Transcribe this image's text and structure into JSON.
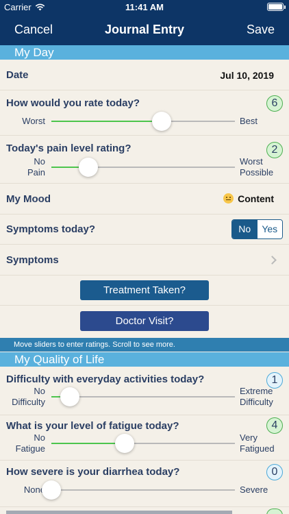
{
  "status_bar": {
    "carrier": "Carrier",
    "time": "11:41 AM"
  },
  "nav": {
    "cancel": "Cancel",
    "title": "Journal Entry",
    "save": "Save"
  },
  "sections": {
    "my_day": "My Day",
    "quality_of_life": "My Quality of Life"
  },
  "date": {
    "label": "Date",
    "value": "Jul 10, 2019"
  },
  "rate_today": {
    "label": "How would you rate today?",
    "value": "6",
    "min_label": "Worst",
    "max_label": "Best",
    "fraction": 0.6
  },
  "pain": {
    "label": "Today's pain level rating?",
    "value": "2",
    "min_label_1": "No",
    "min_label_2": "Pain",
    "max_label_1": "Worst",
    "max_label_2": "Possible",
    "fraction": 0.2
  },
  "mood": {
    "label": "My Mood",
    "value": "Content",
    "icon": "content-face-icon"
  },
  "symptoms_today": {
    "label": "Symptoms today?",
    "no": "No",
    "yes": "Yes",
    "selected": "No"
  },
  "symptoms": {
    "label": "Symptoms"
  },
  "buttons": {
    "treatment": "Treatment Taken?",
    "doctor": "Doctor Visit?"
  },
  "info": "Move sliders to enter ratings. Scroll to see more.",
  "difficulty": {
    "label": "Difficulty with everyday activities today?",
    "value": "1",
    "min_label_1": "No",
    "min_label_2": "Difficulty",
    "max_label_1": "Extreme",
    "max_label_2": "Difficulty",
    "fraction": 0.1
  },
  "fatigue": {
    "label": "What is your level of fatigue today?",
    "value": "4",
    "min_label_1": "No",
    "min_label_2": "Fatigue",
    "max_label_1": "Very",
    "max_label_2": "Fatigued",
    "fraction": 0.4
  },
  "diarrhea": {
    "label": "How severe is your diarrhea today?",
    "value": "0",
    "min_label": "None",
    "max_label": "Severe",
    "fraction": 0.0
  },
  "colors": {
    "nav": "#0d3566",
    "section": "#5ab1dd",
    "accent_green": "#4cc54c",
    "label": "#2a3e63"
  }
}
